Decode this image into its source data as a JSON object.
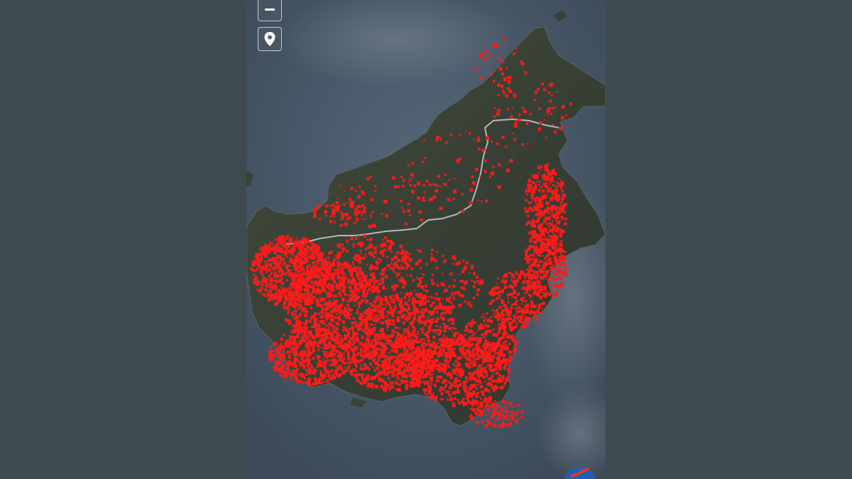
{
  "map": {
    "basemap": "satellite",
    "marker_color": "#ff1a1a",
    "border_color": "#c8d0d0",
    "land_color": "#3a4236",
    "sea_color": "#4e6072"
  },
  "controls": {
    "zoom_out": "zoom-out",
    "locate": "map-pin-icon"
  }
}
